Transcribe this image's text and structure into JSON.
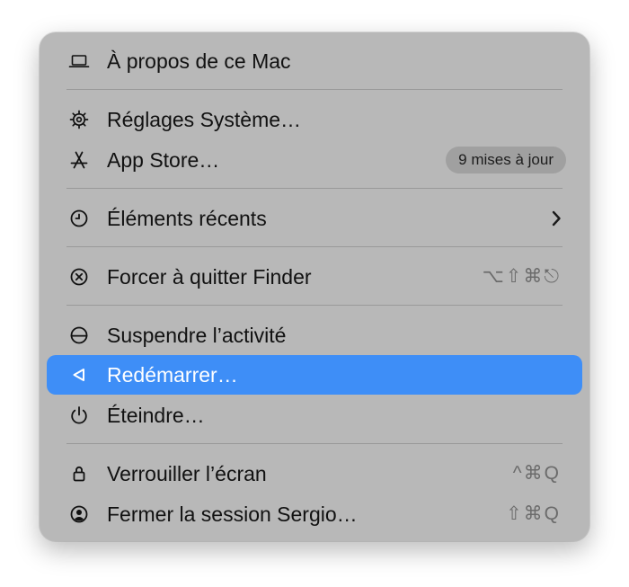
{
  "menu": {
    "items": [
      {
        "label": "À propos de ce Mac",
        "icon": "laptop-icon"
      },
      {
        "label": "Réglages Système…",
        "icon": "gear-icon"
      },
      {
        "label": "App Store…",
        "icon": "app-store-icon",
        "badge": "9 mises à jour"
      },
      {
        "label": "Éléments récents",
        "icon": "clock-icon",
        "submenu": true
      },
      {
        "label": "Forcer à quitter Finder",
        "icon": "force-quit-icon",
        "shortcut": "⌥⇧⌘⎋"
      },
      {
        "label": "Suspendre l’activité",
        "icon": "sleep-icon"
      },
      {
        "label": "Redémarrer…",
        "icon": "restart-icon",
        "highlighted": true
      },
      {
        "label": "Éteindre…",
        "icon": "power-icon"
      },
      {
        "label": "Verrouiller l’écran",
        "icon": "lock-icon",
        "shortcut": "^⌘Q"
      },
      {
        "label": "Fermer la session Sergio…",
        "icon": "user-icon",
        "shortcut": "⇧⌘Q"
      }
    ]
  },
  "colors": {
    "menu_background": "#b8b8b8",
    "highlight": "#3e8ef7",
    "badge_background": "#a0a0a0",
    "shortcut_text": "#6b6b6b"
  }
}
